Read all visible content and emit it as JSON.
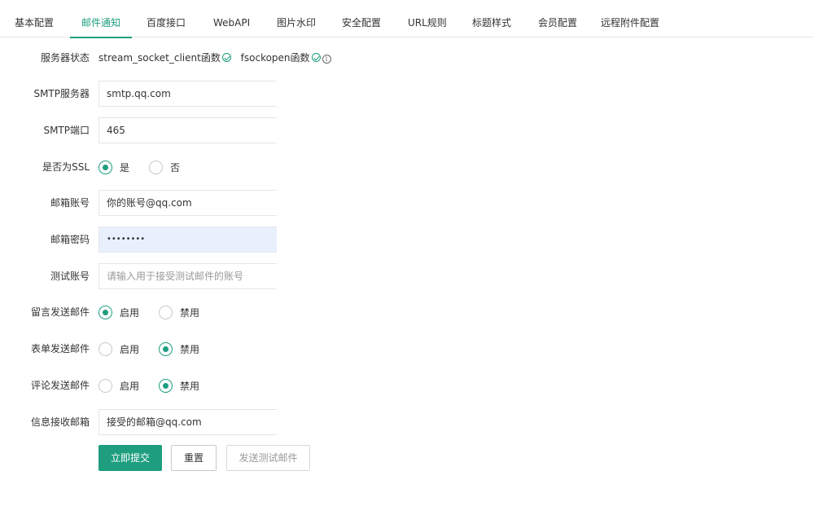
{
  "tabs": [
    {
      "label": "基本配置",
      "active": false
    },
    {
      "label": "邮件通知",
      "active": true
    },
    {
      "label": "百度接口",
      "active": false
    },
    {
      "label": "WebAPI",
      "active": false
    },
    {
      "label": "图片水印",
      "active": false
    },
    {
      "label": "安全配置",
      "active": false
    },
    {
      "label": "URL规则",
      "active": false
    },
    {
      "label": "标题样式",
      "active": false
    },
    {
      "label": "会员配置",
      "active": false
    },
    {
      "label": "远程附件配置",
      "active": false
    }
  ],
  "server_status": {
    "label": "服务器状态",
    "item1": "stream_socket_client函数",
    "item2": "fsockopen函数"
  },
  "smtp_server": {
    "label": "SMTP服务器",
    "value": "smtp.qq.com"
  },
  "smtp_port": {
    "label": "SMTP端口",
    "value": "465"
  },
  "ssl": {
    "label": "是否为SSL",
    "options": [
      "是",
      "否"
    ],
    "selected": "是"
  },
  "mail_account": {
    "label": "邮箱账号",
    "value": "你的账号@qq.com"
  },
  "mail_password": {
    "label": "邮箱密码",
    "value": "••••••••"
  },
  "test_account": {
    "label": "测试账号",
    "placeholder": "请输入用于接受测试邮件的账号"
  },
  "guestbook_mail": {
    "label": "留言发送邮件",
    "options": [
      "启用",
      "禁用"
    ],
    "selected": "启用"
  },
  "form_mail": {
    "label": "表单发送邮件",
    "options": [
      "启用",
      "禁用"
    ],
    "selected": "禁用"
  },
  "comment_mail": {
    "label": "评论发送邮件",
    "options": [
      "启用",
      "禁用"
    ],
    "selected": "禁用"
  },
  "receive_mail": {
    "label": "信息接收邮箱",
    "value": "接受的邮箱@qq.com"
  },
  "buttons": {
    "submit": "立即提交",
    "reset": "重置",
    "send_test": "发送测试邮件"
  },
  "colors": {
    "accent": "#1e9e7f"
  }
}
